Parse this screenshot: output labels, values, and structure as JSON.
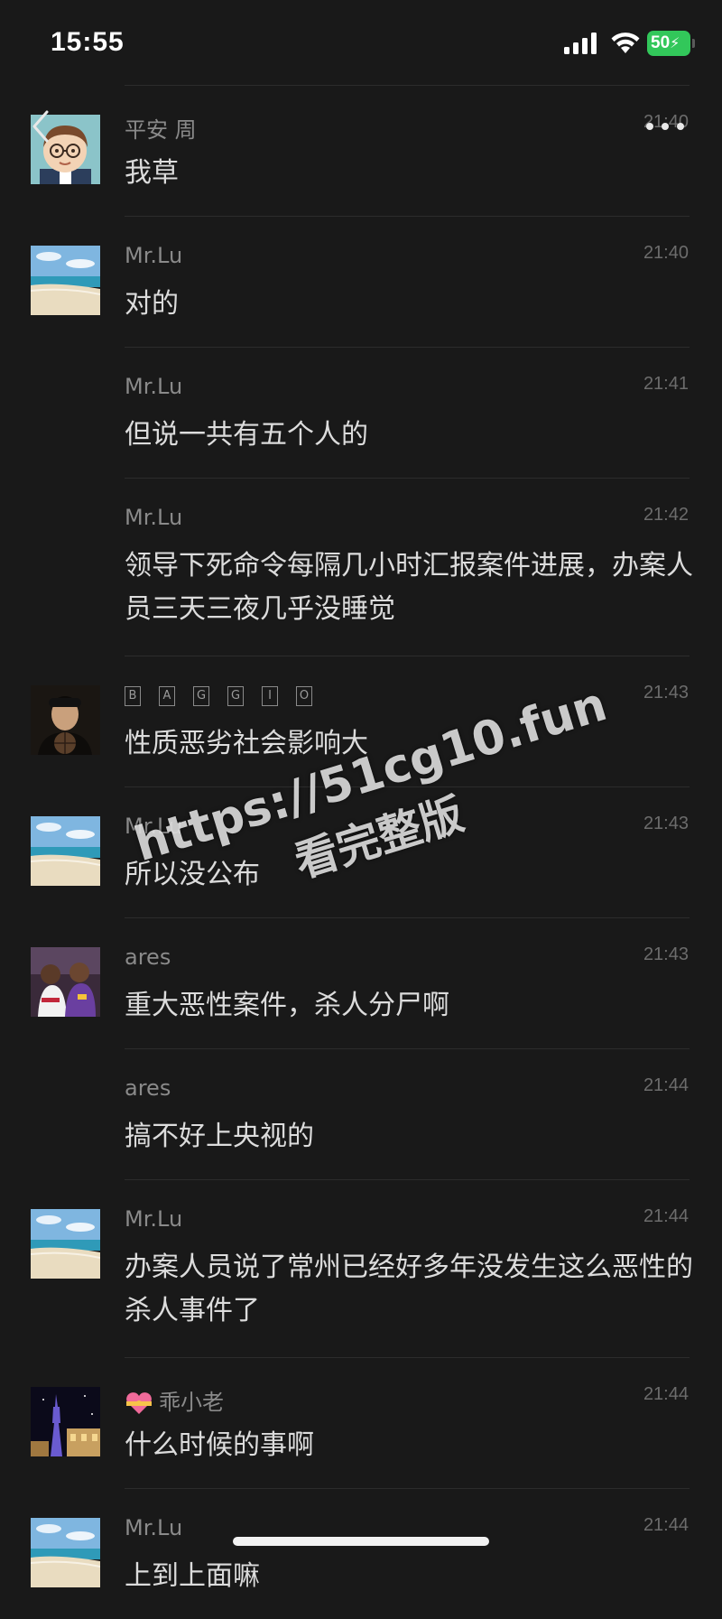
{
  "status_bar": {
    "time": "15:55",
    "battery": "50"
  },
  "header": {
    "back_icon": "chevron-left-icon",
    "more_icon": "more-icon"
  },
  "messages": [
    {
      "sender": "平安  周",
      "time": "21:40",
      "text": "我草",
      "avatar": "cartoon-boy"
    },
    {
      "sender": "Mr.Lu",
      "time": "21:40",
      "text": "对的",
      "avatar": "beach"
    },
    {
      "sender": "Mr.Lu",
      "time": "21:41",
      "text": "但说一共有五个人的",
      "avatar": ""
    },
    {
      "sender": "Mr.Lu",
      "time": "21:42",
      "text": "领导下死命令每隔几小时汇报案件进展，办案人员三天三夜几乎没睡觉",
      "avatar": ""
    },
    {
      "sender": "BAGGIO",
      "time": "21:43",
      "text": "性质恶劣社会影响大",
      "avatar": "man-dark"
    },
    {
      "sender": "Mr.Lu",
      "time": "21:43",
      "text": "所以没公布",
      "avatar": "beach"
    },
    {
      "sender": "ares",
      "time": "21:43",
      "text": "重大恶性案件，杀人分尸啊",
      "avatar": "basketball"
    },
    {
      "sender": "ares",
      "time": "21:44",
      "text": "搞不好上央视的",
      "avatar": ""
    },
    {
      "sender": "Mr.Lu",
      "time": "21:44",
      "text": "办案人员说了常州已经好多年没发生这么恶性的杀人事件了",
      "avatar": "beach"
    },
    {
      "sender": "乖小老",
      "time": "21:44",
      "text": "什么时候的事啊",
      "avatar": "eiffel-night"
    },
    {
      "sender": "Mr.Lu",
      "time": "21:44",
      "text": "上到上面嘛",
      "avatar": "beach"
    }
  ],
  "watermark": {
    "line1": "https://51cg10.fun",
    "line2": "看完整版"
  }
}
